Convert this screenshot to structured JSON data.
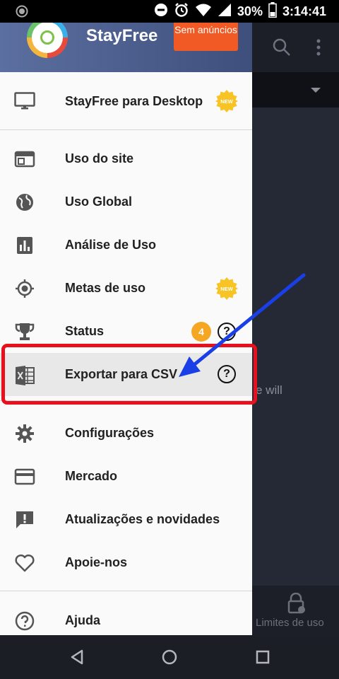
{
  "status_bar": {
    "battery_percent": "30%",
    "time": "3:14:41"
  },
  "header": {
    "app_name": "StayFree",
    "no_ads_badge": "Sem anúncios"
  },
  "menu": {
    "desktop": {
      "label": "StayFree para Desktop",
      "badge": "NEW"
    },
    "site_usage": {
      "label": "Uso do site"
    },
    "global_usage": {
      "label": "Uso Global"
    },
    "usage_analysis": {
      "label": "Análise de Uso"
    },
    "usage_goals": {
      "label": "Metas de uso",
      "badge": "NEW"
    },
    "status": {
      "label": "Status",
      "count": "4",
      "help": "?"
    },
    "export_csv": {
      "label": "Exportar para CSV",
      "help": "?"
    },
    "settings": {
      "label": "Configurações"
    },
    "market": {
      "label": "Mercado"
    },
    "updates": {
      "label": "Atualizações e novidades"
    },
    "support": {
      "label": "Apoie-nos"
    },
    "help": {
      "label": "Ajuda"
    }
  },
  "background": {
    "partial_text": "e will",
    "bottom_tab_label": "Limites de uso"
  },
  "colors": {
    "accent_orange": "#f15a24",
    "highlight_red": "#e8101c",
    "arrow_blue": "#1a3fe6",
    "badge_orange": "#f5a623"
  }
}
